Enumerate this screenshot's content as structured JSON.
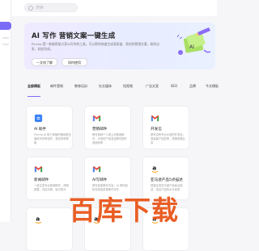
{
  "search": {
    "placeholder": "搜索"
  },
  "hero": {
    "title": "AI 写作 营销文案一键生成",
    "desc": "Pincha 是一款能帮助大家AI写作的工具，可以帮你快速生成高质量、原创的营销文案，助你出彩、轻松完成。",
    "try_button": "一文快了解",
    "start_button": "如何使用"
  },
  "tabs": [
    "全部模板",
    "邮件营销",
    "教育培训",
    "社交媒体",
    "短视频",
    "广告文案",
    "SEO",
    "品牌",
    "今文模板"
  ],
  "cards": [
    {
      "name": "AI 助手",
      "desc": "Pincha AI 助力你随时随地更全面地写作和创作，提供多种帮助",
      "logo": "note-icon"
    },
    {
      "name": "营销邮件",
      "desc": "撰写各种个人或公司营销邮件，为你的产品发送邮件提升营销效率",
      "logo": "gmail-icon"
    },
    {
      "name": "开发信",
      "desc": "撰写具有专业水准的开发信，提高客户回复率，快速拓展业务",
      "logo": "gmail-icon"
    },
    {
      "name": "新闻邮件",
      "desc": "一键生成专业新闻邮件，简明扼要，内容清晰，吸引受众",
      "logo": "gmail-icon"
    },
    {
      "name": "AI写邮件",
      "desc": "撰写各类邮件内容，AI 帮你轻松完成高质量邮件写作",
      "logo": "gmail-icon"
    },
    {
      "name": "亚马逊产品5点描述",
      "desc": "快速生成亚马逊产品卖点描述，突出产品特点与优势",
      "logo": "amazon-icon"
    },
    {
      "name": "",
      "desc": "",
      "logo": "amazon-icon"
    },
    {
      "name": "",
      "desc": "",
      "logo": "amazon-icon"
    },
    {
      "name": "",
      "desc": "",
      "logo": "amazon-icon"
    }
  ],
  "watermark": "百库下载"
}
